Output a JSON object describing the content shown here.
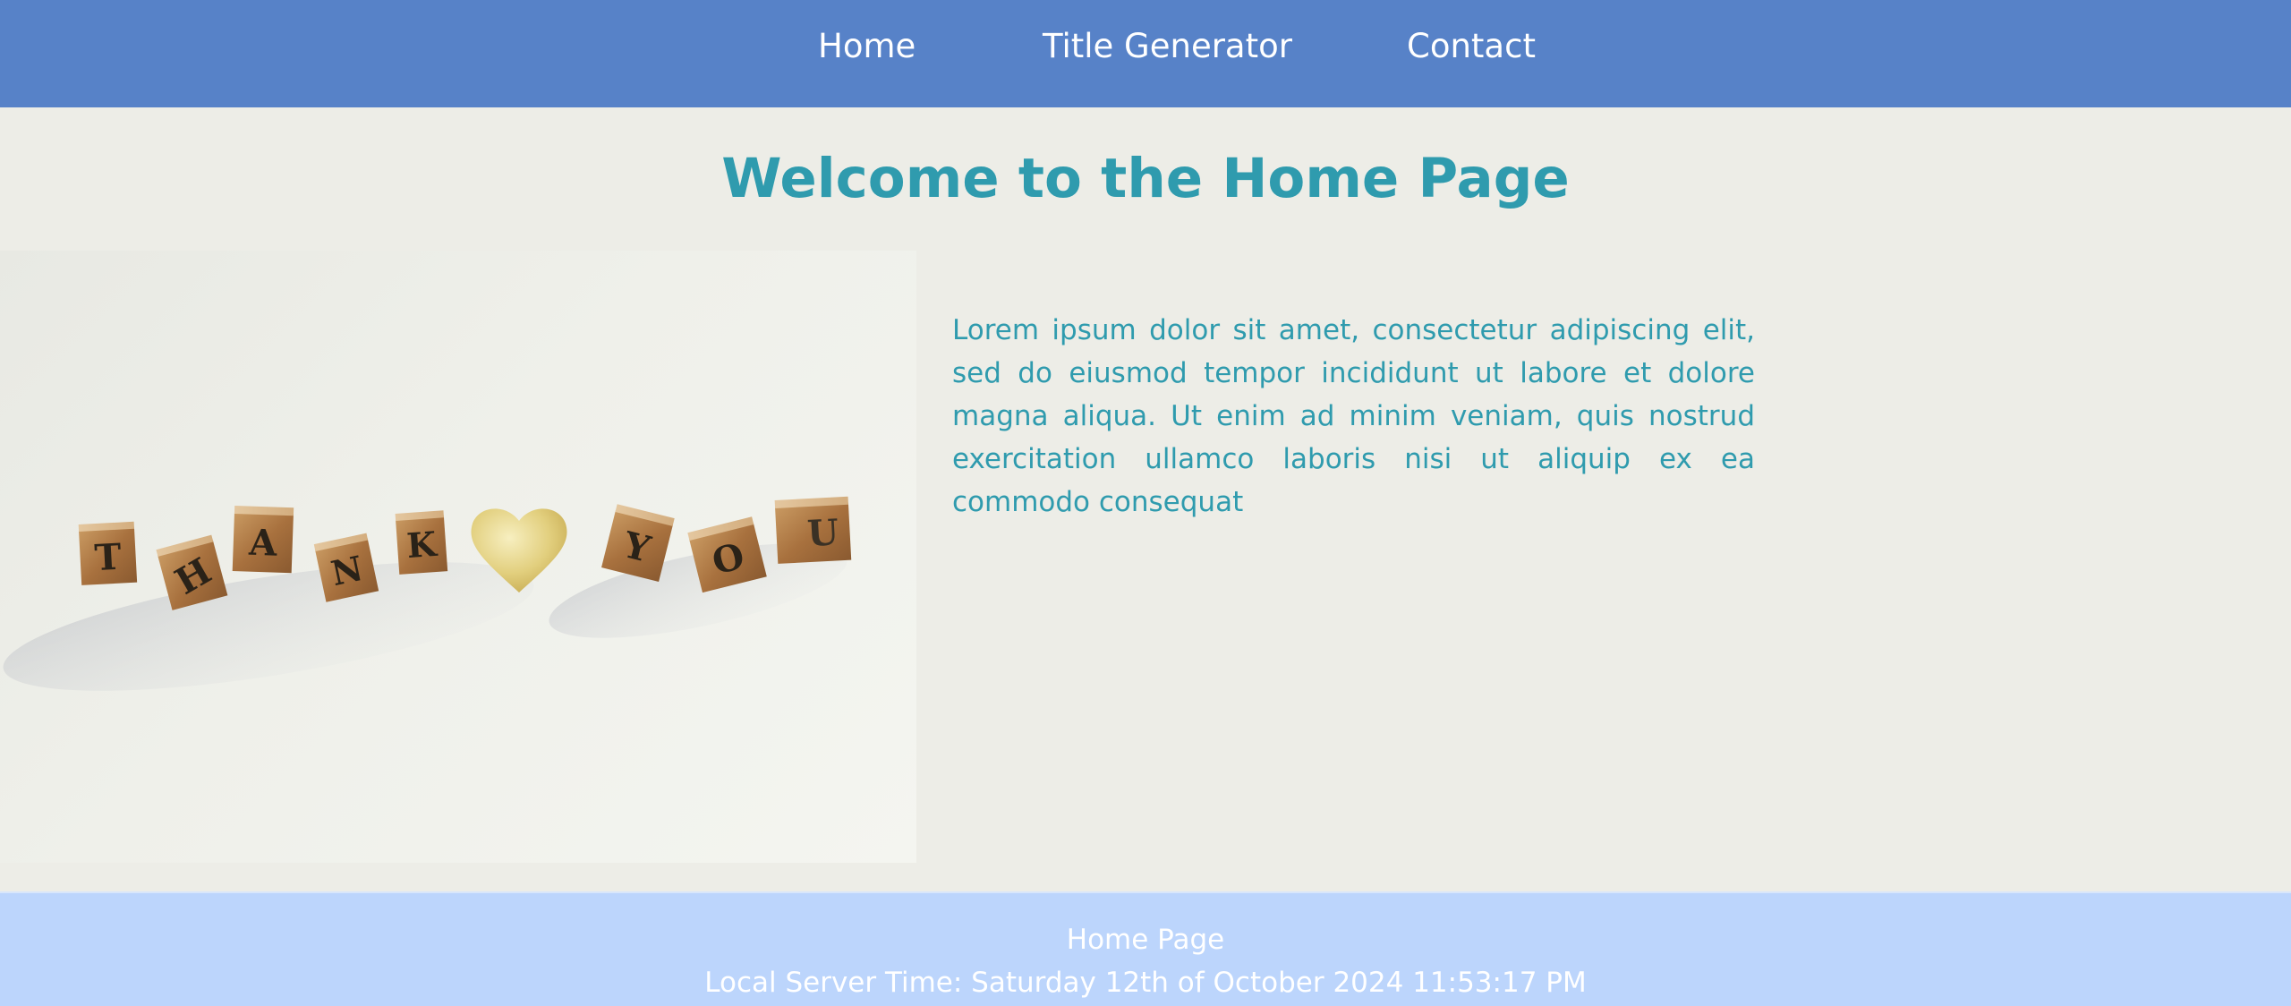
{
  "nav": {
    "items": [
      {
        "label": "Home"
      },
      {
        "label": "Title Generator"
      },
      {
        "label": "Contact"
      }
    ]
  },
  "main": {
    "title": "Welcome to the Home Page",
    "intro": "Lorem ipsum dolor sit amet, consectetur adipiscing elit, sed do eiusmod tempor incididunt ut labore et dolore magna aliqua. Ut enim ad minim veniam, quis nostrud exercitation ullamco laboris nisi ut aliquip ex ea commodo consequat",
    "image": {
      "letters": [
        "T",
        "H",
        "A",
        "N",
        "K",
        "Y",
        "O",
        "U"
      ]
    }
  },
  "footer": {
    "page_name": "Home Page",
    "server_time": "Local Server Time: Saturday 12th of October 2024 11:53:17 PM"
  },
  "colors": {
    "navbar": "#5782c8",
    "accent_text": "#2f9bae",
    "page_background": "#edede7",
    "footer": "#bcd5fc"
  }
}
